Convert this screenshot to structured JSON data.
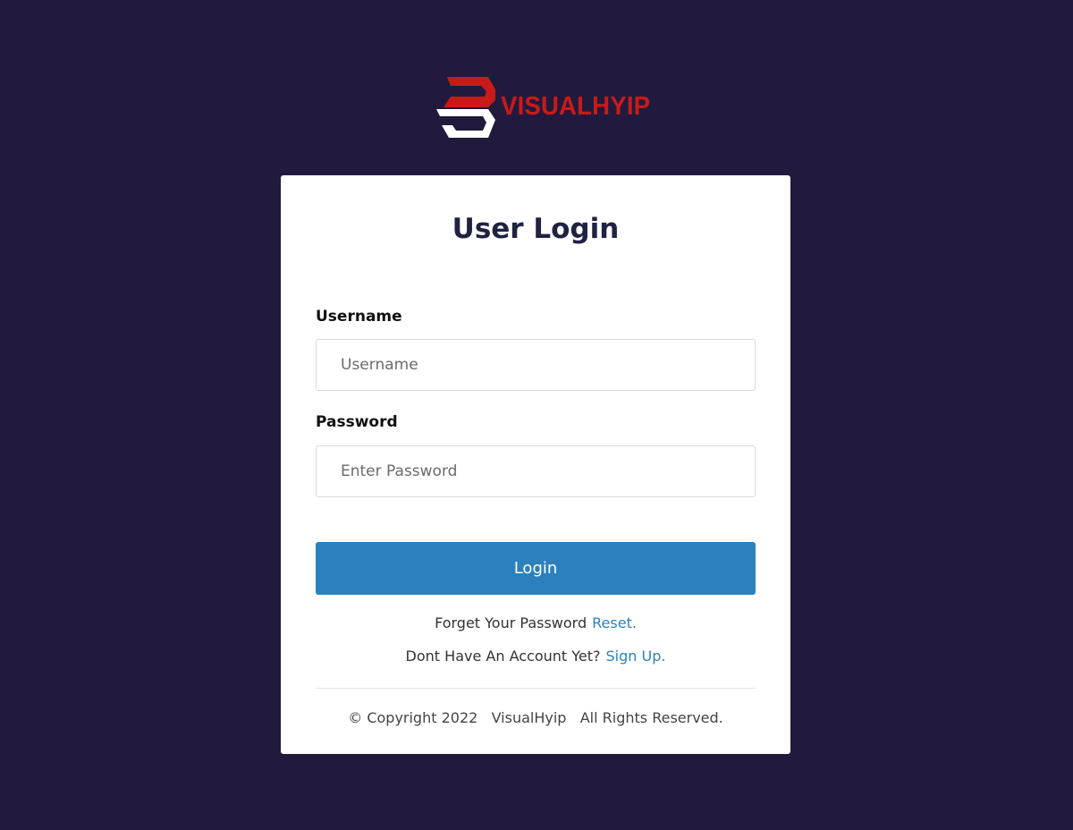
{
  "brand": {
    "name": "VISUALHYIP",
    "color": "#c91a1a"
  },
  "login_card": {
    "title": "User Login",
    "username": {
      "label": "Username",
      "placeholder": "Username",
      "value": ""
    },
    "password": {
      "label": "Password",
      "placeholder": "Enter Password",
      "value": ""
    },
    "login_button": "Login",
    "forgot": {
      "text": "Forget Your Password",
      "link": "Reset."
    },
    "signup": {
      "text": "Dont Have An Account Yet?",
      "link": "Sign Up."
    },
    "footer": {
      "copyright": "© Copyright 2022",
      "company": "VisualHyip",
      "rights": "All Rights Reserved."
    }
  },
  "colors": {
    "background": "#211a3c",
    "accent": "#2c80bd",
    "card": "#ffffff"
  }
}
